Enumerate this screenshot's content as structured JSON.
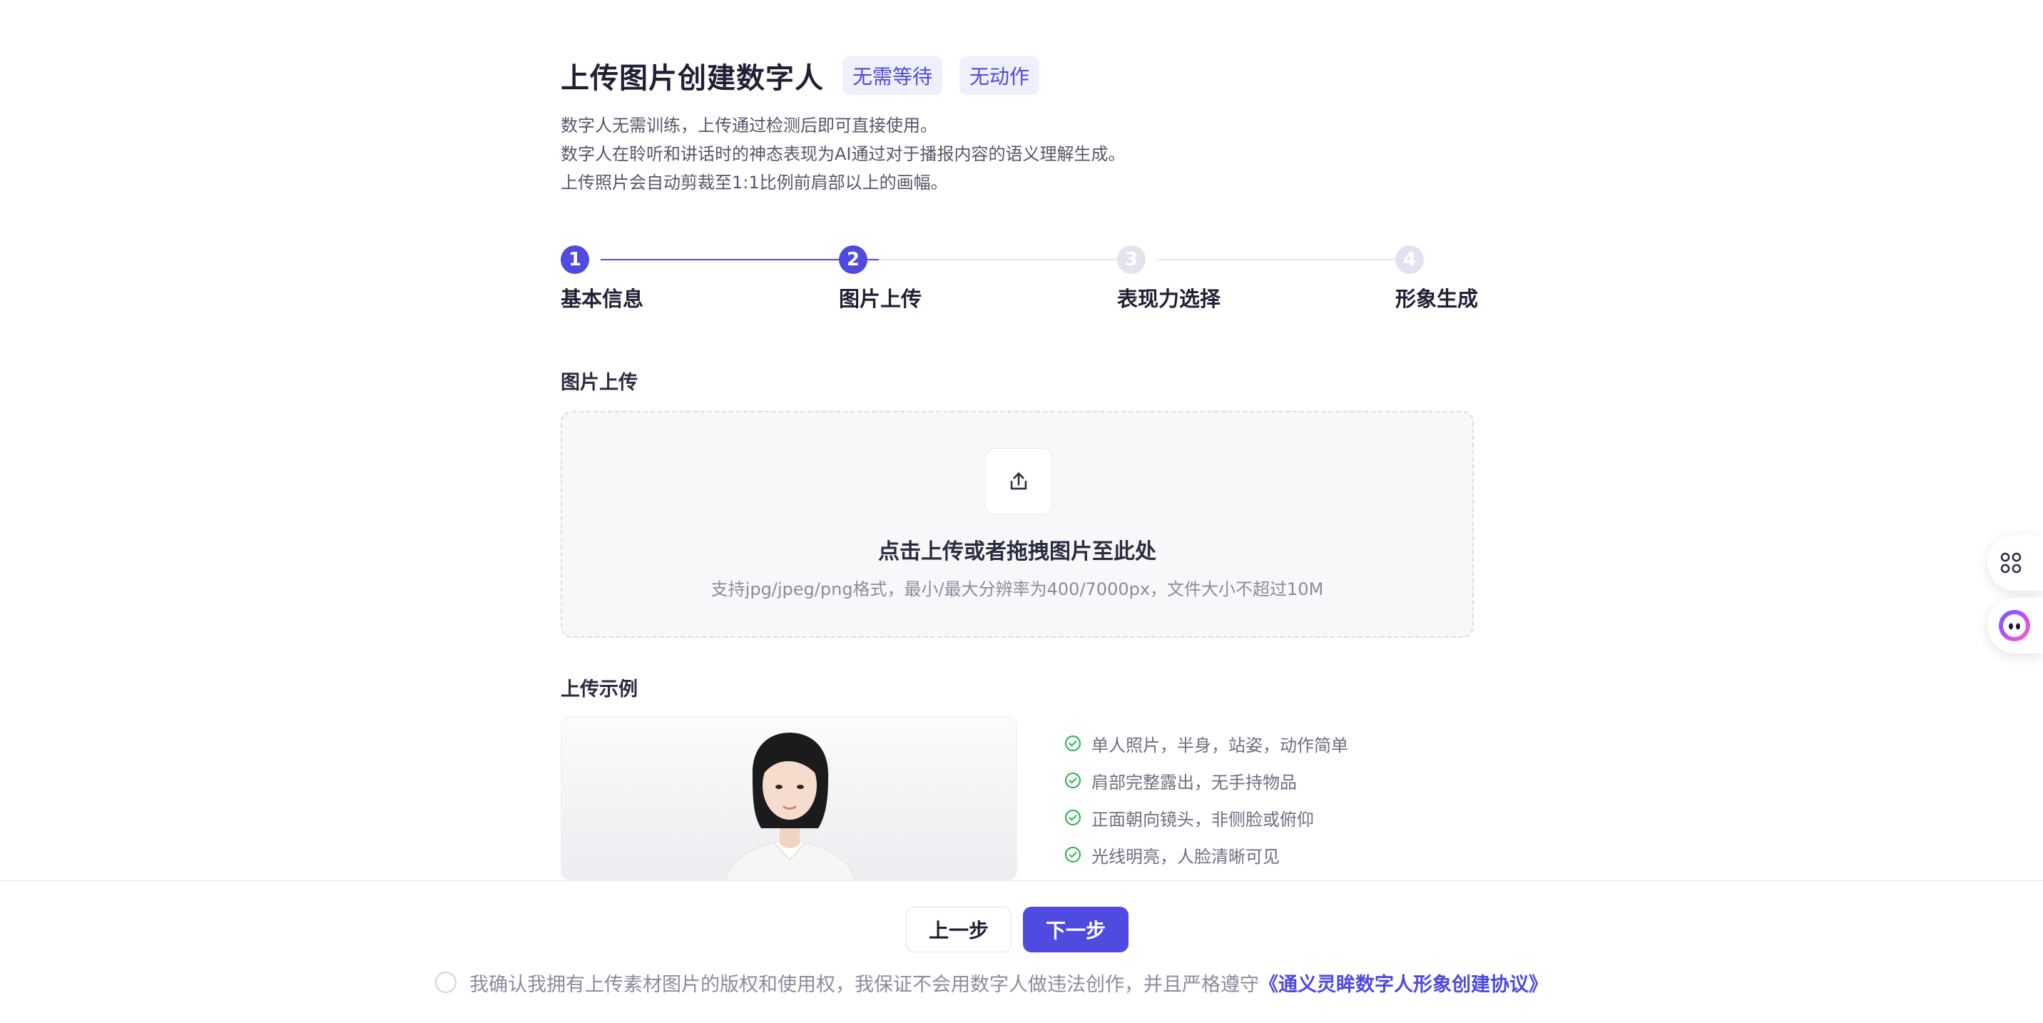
{
  "header": {
    "title": "上传图片创建数字人",
    "tags": [
      "无需等待",
      "无动作"
    ],
    "description": [
      "数字人无需训练，上传通过检测后即可直接使用。",
      "数字人在聆听和讲话时的神态表现为AI通过对于播报内容的语义理解生成。",
      "上传照片会自动剪裁至1:1比例前肩部以上的画幅。"
    ]
  },
  "steps": [
    {
      "number": "1",
      "label": "基本信息",
      "state": "done"
    },
    {
      "number": "2",
      "label": "图片上传",
      "state": "current"
    },
    {
      "number": "3",
      "label": "表现力选择",
      "state": "todo"
    },
    {
      "number": "4",
      "label": "形象生成",
      "state": "todo"
    }
  ],
  "upload": {
    "section_title": "图片上传",
    "main_text": "点击上传或者拖拽图片至此处",
    "sub_text": "支持jpg/jpeg/png格式，最小/最大分辨率为400/7000px，文件大小不超过10M",
    "icon": "upload-icon"
  },
  "example": {
    "section_title": "上传示例",
    "requirements": [
      "单人照片，半身，站姿，动作简单",
      "肩部完整露出，无手持物品",
      "正面朝向镜头，非侧脸或俯仰",
      "光线明亮，人脸清晰可见"
    ]
  },
  "footer": {
    "prev_label": "上一步",
    "next_label": "下一步",
    "agreement_text": "我确认我拥有上传素材图片的版权和使用权，我保证不会用数字人做违法创作，并且严格遵守",
    "agreement_link": "《通义灵眸数字人形象创建协议》"
  },
  "colors": {
    "accent": "#4f4ae0",
    "success": "#22b14c",
    "text": "#1f2033"
  },
  "floating": [
    "apps-icon",
    "assistant-icon"
  ]
}
